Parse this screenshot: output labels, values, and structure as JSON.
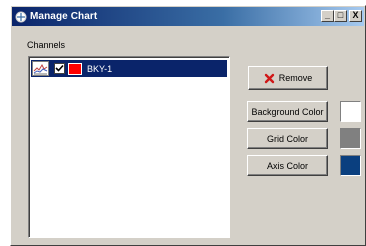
{
  "window": {
    "title": "Manage Chart",
    "minimize_label": "_",
    "restore_label": "□",
    "close_label": "X"
  },
  "channels": {
    "label": "Channels",
    "items": [
      {
        "label": "BKY-1",
        "checked": true,
        "color": "#ff0000",
        "selected": true
      }
    ]
  },
  "buttons": {
    "remove_label": "Remove",
    "background_color_label": "Background Color",
    "grid_color_label": "Grid Color",
    "axis_color_label": "Axis Color"
  },
  "colors": {
    "background": "#ffffff",
    "grid": "#808080",
    "axis": "#0a3f7f",
    "selection": "#0a246a"
  }
}
